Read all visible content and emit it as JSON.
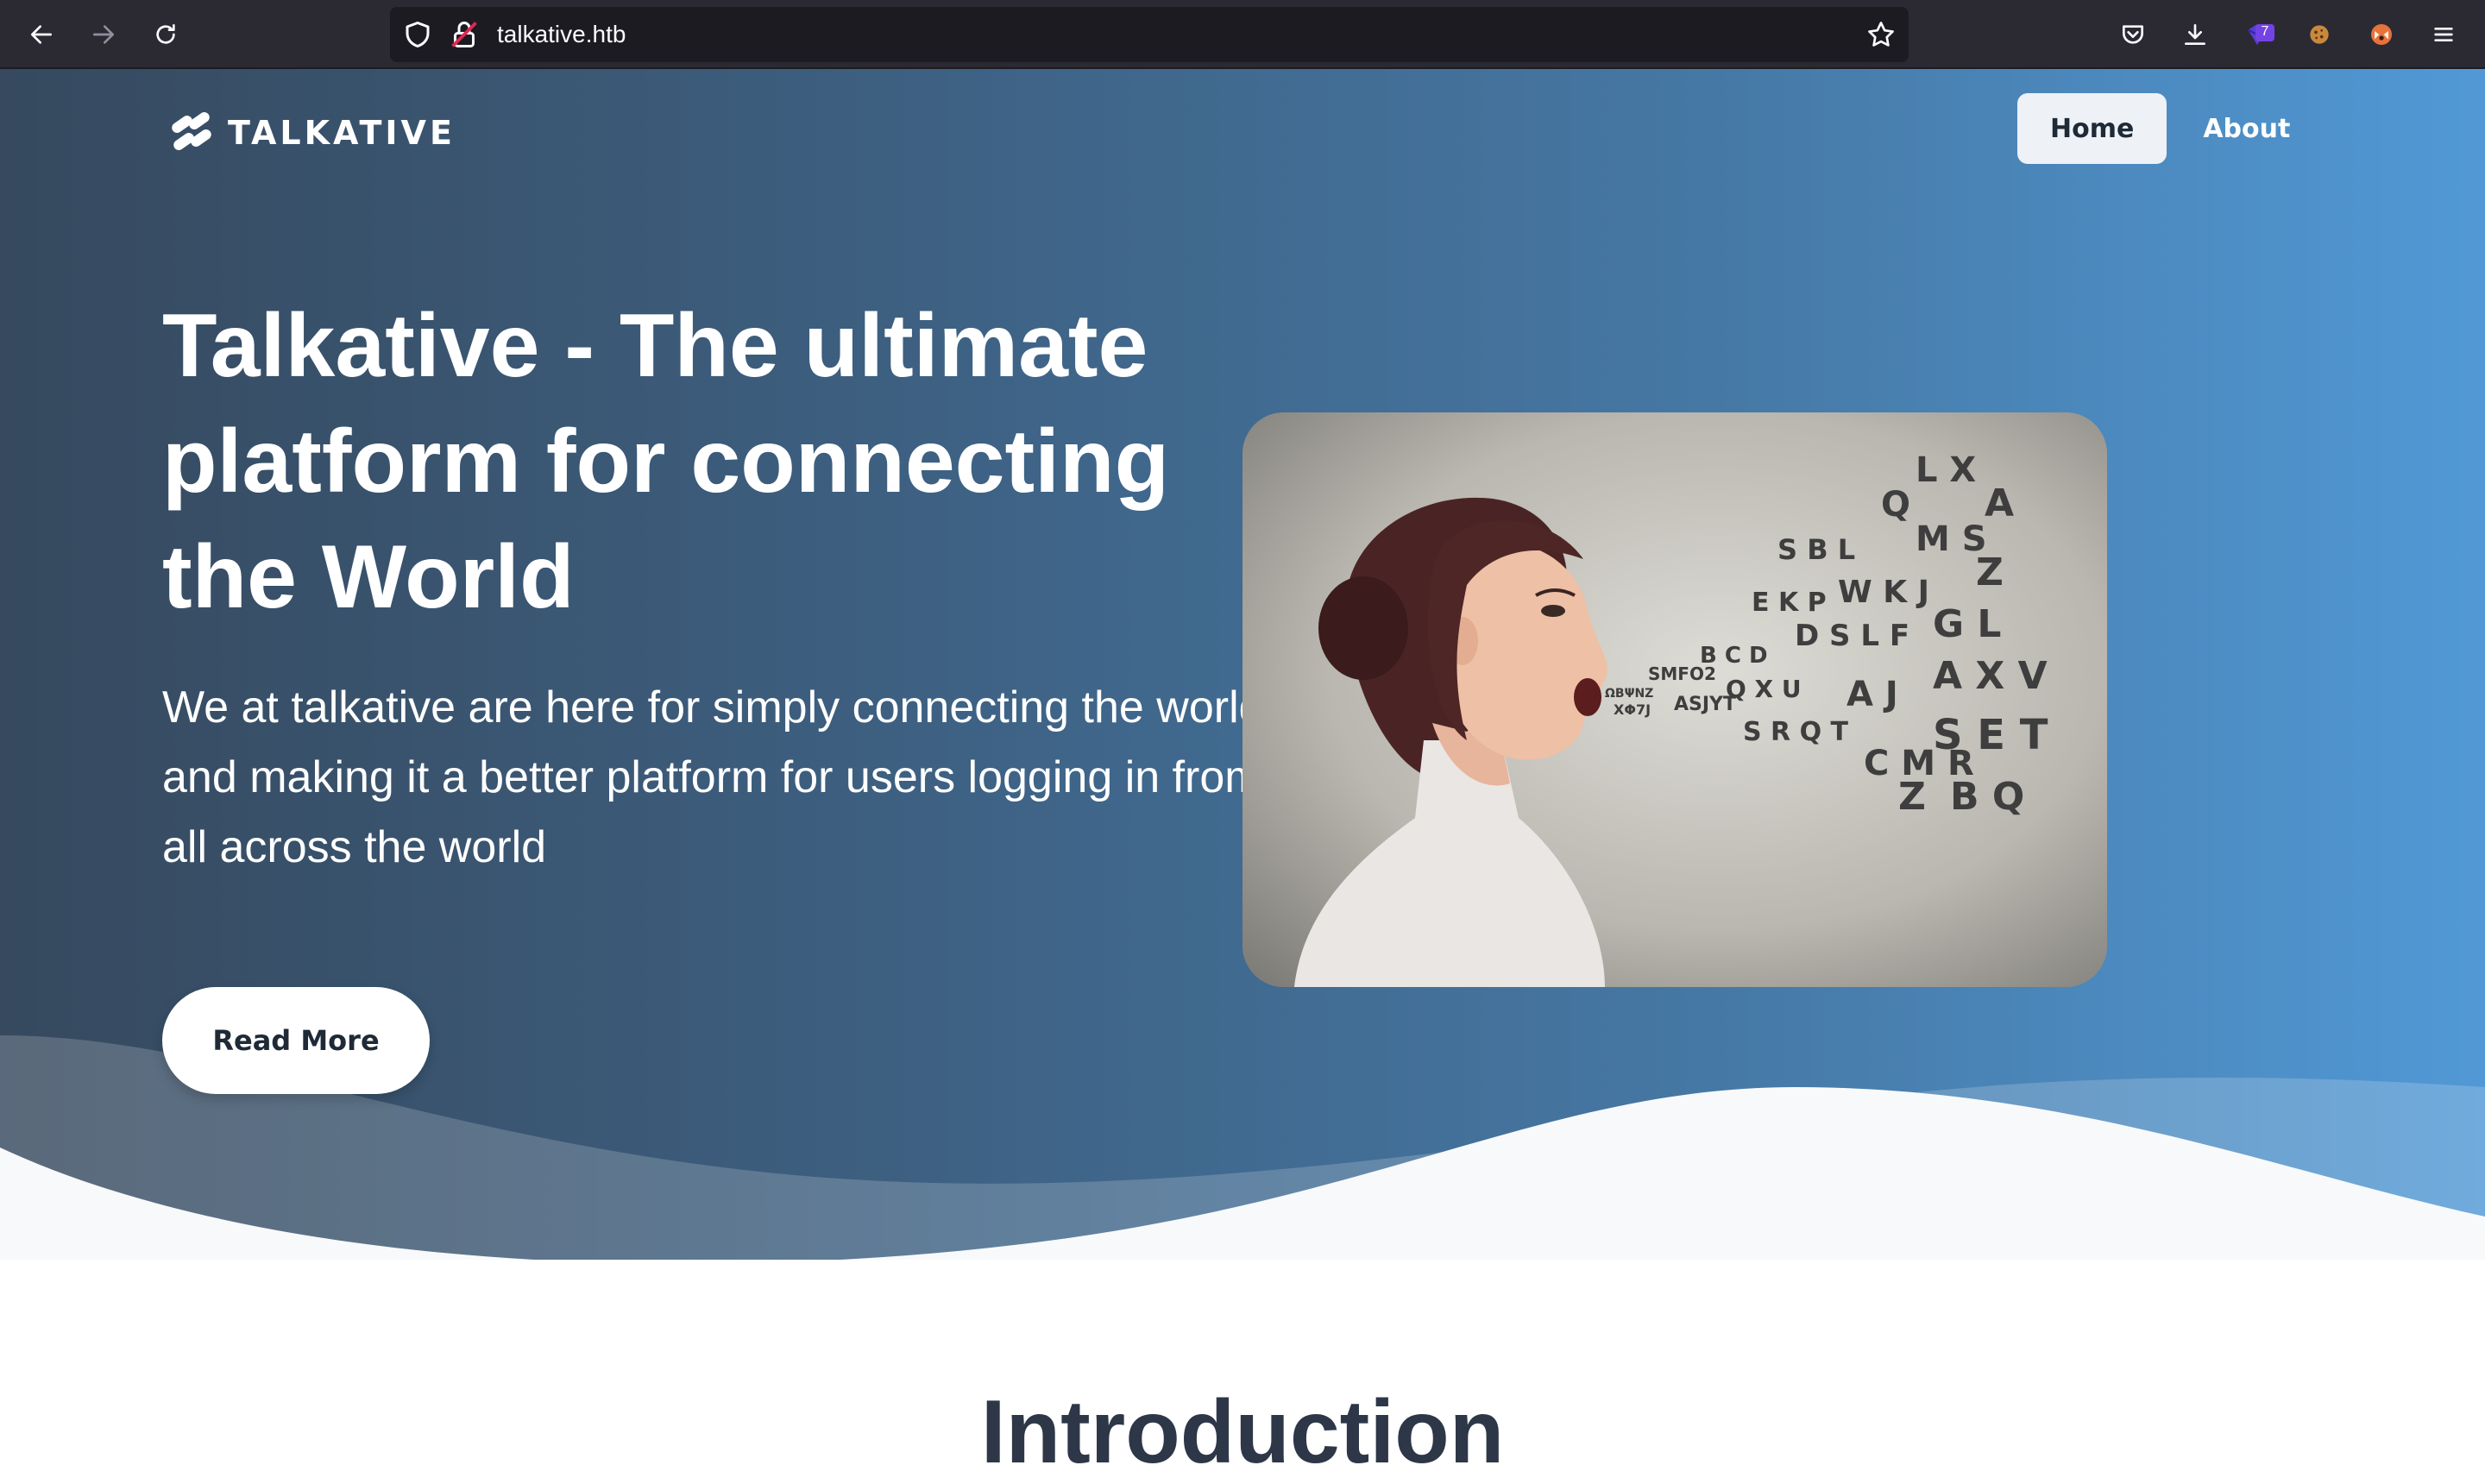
{
  "browser": {
    "url": "talkative.htb",
    "extension_badge": "7",
    "icons": [
      "back-arrow-icon",
      "forward-arrow-icon",
      "reload-icon",
      "shield-icon",
      "lock-icon",
      "star-icon",
      "pocket-icon",
      "download-icon",
      "extension-icon",
      "cookie-icon",
      "fox-extension-icon",
      "menu-icon"
    ]
  },
  "site": {
    "logo_text": "TALKATIVE",
    "nav": [
      {
        "label": "Home",
        "active": true
      },
      {
        "label": "About",
        "active": false
      }
    ]
  },
  "hero": {
    "title": "Talkative - The ultimate platform for connecting the World",
    "subtitle": "We at talkative are here for simply connecting the world and making it a better platform for users logging in from all across the world",
    "cta_label": "Read More",
    "image_alt": "woman speaking letters"
  },
  "intro": {
    "title": "Introduction"
  },
  "colors": {
    "chrome_bg": "#2b2a33",
    "hero_start": "#36495e",
    "hero_end": "#5199d6",
    "heading_dark": "#2d3748"
  }
}
